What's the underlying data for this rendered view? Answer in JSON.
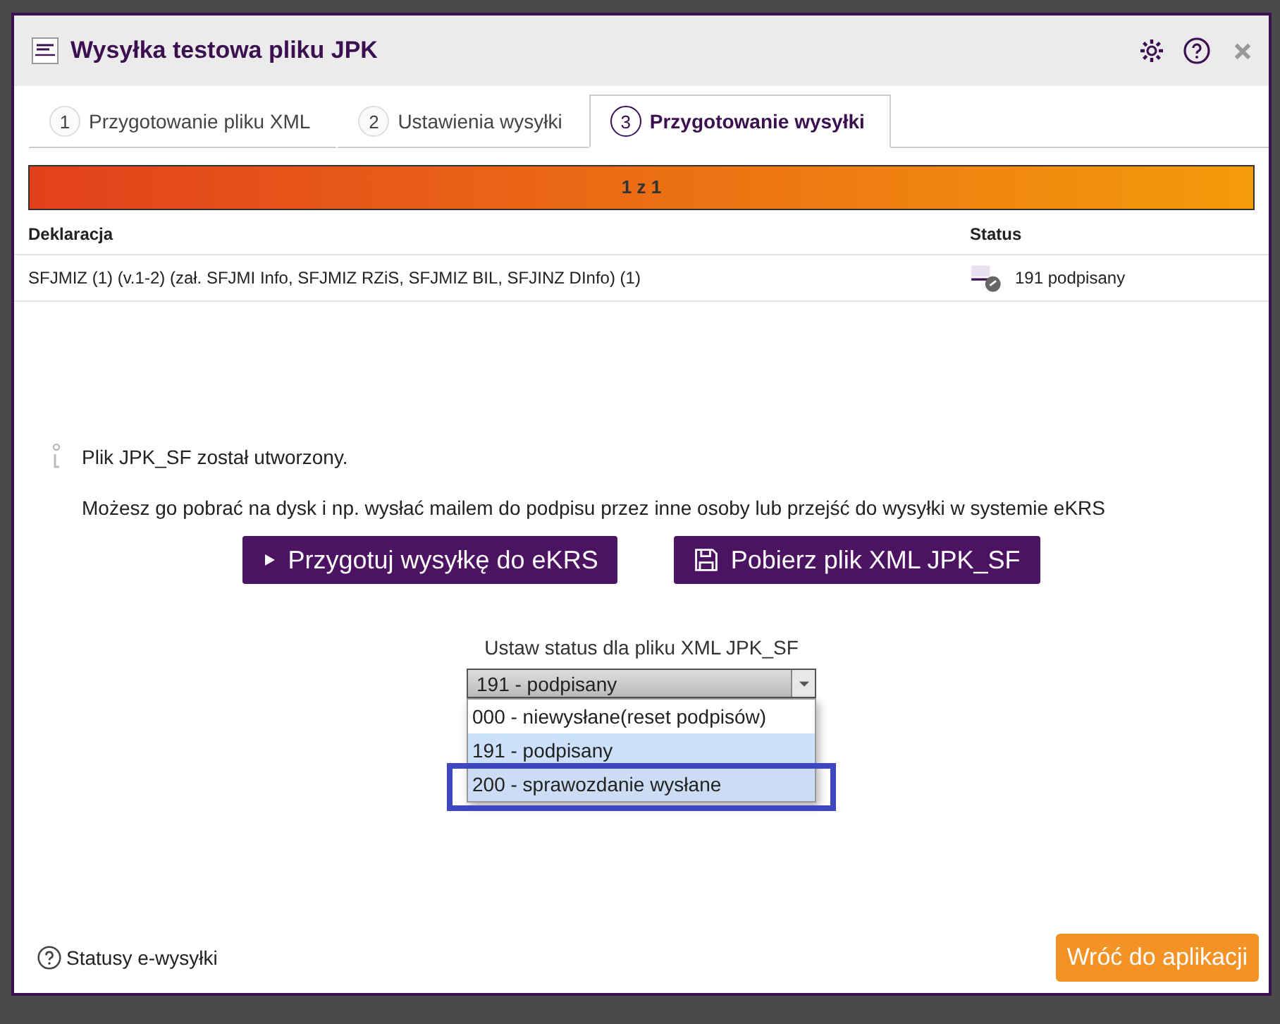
{
  "window": {
    "title": "Wysyłka testowa pliku JPK"
  },
  "tabs": [
    {
      "number": "1",
      "label": "Przygotowanie pliku XML",
      "selected": false
    },
    {
      "number": "2",
      "label": "Ustawienia wysyłki",
      "selected": false
    },
    {
      "number": "3",
      "label": "Przygotowanie wysyłki",
      "selected": true
    }
  ],
  "progress": {
    "label": "1 z 1",
    "level": 1
  },
  "table": {
    "columns": [
      "Deklaracja",
      "Status"
    ],
    "rows": [
      {
        "declaration": "SFJMIZ (1) (v.1-2) (zał. SFJMI Info, SFJMIZ RZiS, SFJMIZ BIL, SFJINZ DInfo) (1)",
        "status": "191 podpisany"
      }
    ]
  },
  "info": {
    "message": "Plik JPK_SF został utworzony.",
    "description": "Możesz go pobrać na dysk i np. wysłać mailem do podpisu przez inne osoby lub przejść do wysyłki w systemie eKRS"
  },
  "buttons": [
    {
      "kind": "play",
      "label": "Przygotuj wysyłkę do eKRS"
    },
    {
      "kind": "save",
      "label": "Pobierz plik XML JPK_SF"
    }
  ],
  "status_select": {
    "label": "Ustaw status dla pliku XML JPK_SF",
    "value": "191 - podpisany",
    "expanded": true,
    "options": [
      {
        "label": "000 - niewysłane(reset podpisów)",
        "selected": false,
        "hovered": false,
        "annotated": false
      },
      {
        "label": "191 - podpisany",
        "selected": true,
        "hovered": false,
        "annotated": false
      },
      {
        "label": "200 - sprawozdanie wysłane",
        "selected": false,
        "hovered": true,
        "annotated": true
      }
    ]
  },
  "footer": {
    "help_link": "Statusy e-wysyłki",
    "back_button": "Wróć do aplikacji"
  }
}
